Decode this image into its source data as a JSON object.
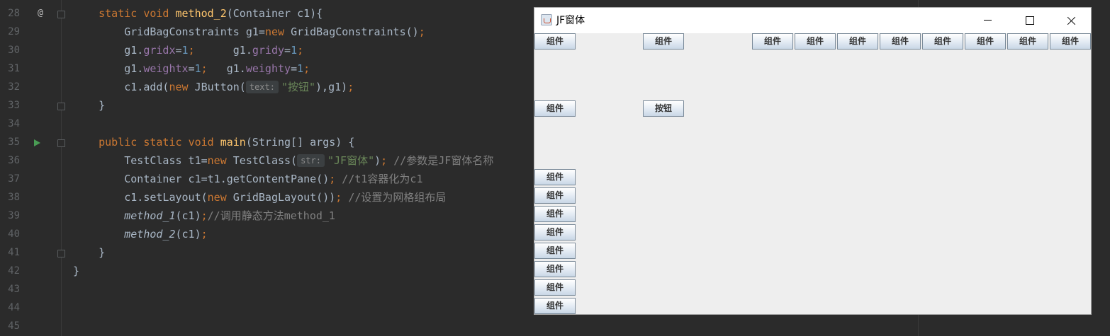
{
  "editor": {
    "lines": [
      {
        "num": "28",
        "segs": [
          {
            "t": "    "
          },
          {
            "t": "static ",
            "c": "kw"
          },
          {
            "t": "void ",
            "c": "kw"
          },
          {
            "t": "method_2",
            "c": "fn"
          },
          {
            "t": "(Container c1){"
          }
        ]
      },
      {
        "num": "29",
        "segs": [
          {
            "t": "        GridBagConstraints g1="
          },
          {
            "t": "new ",
            "c": "kw"
          },
          {
            "t": "GridBagConstraints()"
          },
          {
            "t": ";",
            "c": "kw"
          }
        ]
      },
      {
        "num": "30",
        "segs": [
          {
            "t": "        g1."
          },
          {
            "t": "gridx",
            "c": "fld"
          },
          {
            "t": "="
          },
          {
            "t": "1",
            "c": "num"
          },
          {
            "t": ";",
            "c": "kw"
          },
          {
            "t": "      g1."
          },
          {
            "t": "gridy",
            "c": "fld"
          },
          {
            "t": "="
          },
          {
            "t": "1",
            "c": "num"
          },
          {
            "t": ";",
            "c": "kw"
          }
        ]
      },
      {
        "num": "31",
        "segs": [
          {
            "t": "        g1."
          },
          {
            "t": "weightx",
            "c": "fld"
          },
          {
            "t": "="
          },
          {
            "t": "1",
            "c": "num"
          },
          {
            "t": ";",
            "c": "kw"
          },
          {
            "t": "   g1."
          },
          {
            "t": "weighty",
            "c": "fld"
          },
          {
            "t": "="
          },
          {
            "t": "1",
            "c": "num"
          },
          {
            "t": ";",
            "c": "kw"
          }
        ]
      },
      {
        "num": "32",
        "segs": [
          {
            "t": "        c1.add("
          },
          {
            "t": "new ",
            "c": "kw"
          },
          {
            "t": "JButton("
          },
          {
            "t": "text:",
            "c": "hint"
          },
          {
            "t": "\"按钮\"",
            "c": "str"
          },
          {
            "t": "),g1)"
          },
          {
            "t": ";",
            "c": "kw"
          }
        ]
      },
      {
        "num": "33",
        "segs": [
          {
            "t": "    }"
          }
        ]
      },
      {
        "num": "34",
        "segs": []
      },
      {
        "num": "35",
        "segs": [
          {
            "t": "    "
          },
          {
            "t": "public ",
            "c": "kw"
          },
          {
            "t": "static ",
            "c": "kw"
          },
          {
            "t": "void ",
            "c": "kw"
          },
          {
            "t": "main",
            "c": "fn"
          },
          {
            "t": "(String[] args) {"
          }
        ]
      },
      {
        "num": "36",
        "segs": [
          {
            "t": "        TestClass t1="
          },
          {
            "t": "new ",
            "c": "kw"
          },
          {
            "t": "TestClass("
          },
          {
            "t": "str:",
            "c": "hint"
          },
          {
            "t": "\"JF窗体\"",
            "c": "str"
          },
          {
            "t": ")"
          },
          {
            "t": "; ",
            "c": "kw"
          },
          {
            "t": "//参数是JF窗体名称",
            "c": "cmt"
          }
        ]
      },
      {
        "num": "37",
        "segs": [
          {
            "t": "        Container c1=t1.getContentPane()"
          },
          {
            "t": "; ",
            "c": "kw"
          },
          {
            "t": "//t1容器化为c1",
            "c": "cmt"
          }
        ]
      },
      {
        "num": "38",
        "segs": [
          {
            "t": "        c1.setLayout("
          },
          {
            "t": "new ",
            "c": "kw"
          },
          {
            "t": "GridBagLayout())"
          },
          {
            "t": "; ",
            "c": "kw"
          },
          {
            "t": "//设置为网格组布局",
            "c": "cmt"
          }
        ]
      },
      {
        "num": "39",
        "segs": [
          {
            "t": "        "
          },
          {
            "t": "method_1",
            "c": "ital"
          },
          {
            "t": "(c1)"
          },
          {
            "t": ";",
            "c": "kw"
          },
          {
            "t": "//调用静态方法method_1",
            "c": "cmt"
          }
        ]
      },
      {
        "num": "40",
        "segs": [
          {
            "t": "        "
          },
          {
            "t": "method_2",
            "c": "ital"
          },
          {
            "t": "(c1)"
          },
          {
            "t": ";",
            "c": "kw"
          }
        ]
      },
      {
        "num": "41",
        "segs": [
          {
            "t": "    }"
          }
        ]
      },
      {
        "num": "42",
        "segs": [
          {
            "t": "}"
          }
        ]
      },
      {
        "num": "43",
        "segs": []
      },
      {
        "num": "44",
        "segs": []
      },
      {
        "num": "45",
        "segs": []
      }
    ],
    "gutter": {
      "override_mark": "@"
    }
  },
  "window": {
    "title": "JF窗体",
    "buttons": [
      {
        "label": "组件"
      },
      {
        "label": "组件"
      },
      {
        "label": "组件"
      },
      {
        "label": "组件"
      },
      {
        "label": "组件"
      },
      {
        "label": "组件"
      },
      {
        "label": "组件"
      },
      {
        "label": "组件"
      },
      {
        "label": "组件"
      },
      {
        "label": "组件"
      },
      {
        "label": "组件"
      },
      {
        "label": "按钮"
      },
      {
        "label": "组件"
      },
      {
        "label": "组件"
      },
      {
        "label": "组件"
      },
      {
        "label": "组件"
      },
      {
        "label": "组件"
      },
      {
        "label": "组件"
      },
      {
        "label": "组件"
      },
      {
        "label": "组件"
      }
    ]
  }
}
